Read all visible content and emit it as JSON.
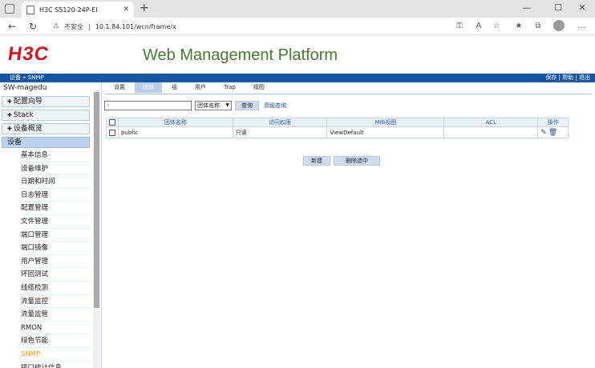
{
  "browser": {
    "tab_title": "H3C S5120-24P-EI",
    "security_label": "不安全",
    "url": "10.1.84.101/wcn/frame/x",
    "new_tab_symbol": "+",
    "window": {
      "minimize": "—",
      "maximize": "☐",
      "close": "✕"
    }
  },
  "header": {
    "logo": "H3C",
    "platform_title": "Web Management Platform",
    "breadcrumb": "设备 » SNMP",
    "links": {
      "save": "保存",
      "help": "帮助",
      "logout": "退出",
      "sep": " | "
    }
  },
  "sidebar": {
    "device_name": "SW-magedu",
    "groups": [
      {
        "label": "配置向导"
      },
      {
        "label": "Stack"
      },
      {
        "label": "设备概览"
      },
      {
        "label": "设备"
      }
    ],
    "items": [
      "基本信息",
      "设备维护",
      "日期和时间",
      "日志管理",
      "配置管理",
      "文件管理",
      "端口管理",
      "端口镜像",
      "用户管理",
      "环回测试",
      "线缆检测",
      "流量监控",
      "流量监管",
      "RMON",
      "绿色节能",
      "SNMP",
      "接口统计信息"
    ],
    "current_item": "SNMP"
  },
  "content": {
    "tabs": [
      "设置",
      "团体",
      "组",
      "用户",
      "Trap",
      "视图"
    ],
    "active_tab": "团体",
    "search": {
      "placeholder": "",
      "field_select": "团体名称",
      "query_button": "查询",
      "advanced_link": "高级查询"
    },
    "table": {
      "headers": [
        "团体名称",
        "访问权限",
        "MIB视图",
        "ACL",
        "操作"
      ],
      "rows": [
        {
          "name": "public",
          "access": "只读",
          "mib_view": "ViewDefault",
          "acl": ""
        }
      ]
    },
    "buttons": {
      "new": "新建",
      "delete_selected": "删除选中"
    }
  },
  "colors": {
    "brand_red": "#d8141f",
    "title_green": "#4a7a30",
    "bar_blue": "#15569e",
    "active_orange": "#f29a2b"
  }
}
